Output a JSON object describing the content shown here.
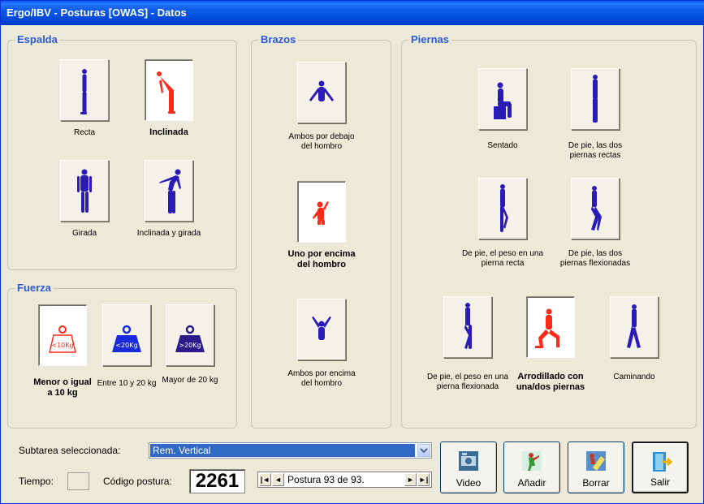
{
  "window": {
    "title": "Ergo/IBV - Posturas [OWAS] - Datos"
  },
  "groups": {
    "espalda": {
      "title": "Espalda",
      "options": [
        {
          "label": "Recta",
          "selected": false
        },
        {
          "label": "Inclinada",
          "selected": true
        },
        {
          "label": "Girada",
          "selected": false
        },
        {
          "label": "Inclinada y girada",
          "selected": false
        }
      ]
    },
    "brazos": {
      "title": "Brazos",
      "options": [
        {
          "label": "Ambos por debajo del hombro",
          "selected": false
        },
        {
          "label": "Uno por encima del hombro",
          "selected": true
        },
        {
          "label": "Ambos por encima del hombro",
          "selected": false
        }
      ]
    },
    "piernas": {
      "title": "Piernas",
      "options": [
        {
          "label": "Sentado",
          "selected": false
        },
        {
          "label": "De pie, las dos piernas rectas",
          "selected": false
        },
        {
          "label": "De pie, el peso en una pierna recta",
          "selected": false
        },
        {
          "label": "De pie, las dos piernas flexionadas",
          "selected": false
        },
        {
          "label": "De pie, el peso en una pierna flexionada",
          "selected": false
        },
        {
          "label": "Arrodillado con una/dos piernas",
          "selected": true
        },
        {
          "label": "Caminando",
          "selected": false
        }
      ]
    },
    "fuerza": {
      "title": "Fuerza",
      "options": [
        {
          "label": "Menor o igual a 10 kg",
          "weight_text": "<10Kg",
          "selected": true
        },
        {
          "label": "Entre 10 y 20 kg",
          "weight_text": "<20Kg",
          "selected": false
        },
        {
          "label": "Mayor de 20 kg",
          "weight_text": ">20Kg",
          "selected": false
        }
      ]
    }
  },
  "bottom": {
    "subtarea_label": "Subtarea seleccionada:",
    "subtarea_value": "Rem. Vertical",
    "tiempo_label": "Tiempo:",
    "codigo_label": "Código postura:",
    "codigo_value": "2261",
    "navigator_text": "Postura 93 de 93.",
    "buttons": {
      "video": "Video",
      "anadir": "Añadir",
      "borrar": "Borrar",
      "salir": "Salir"
    }
  },
  "colors": {
    "selected_figure": "#ff2a1a",
    "normal_figure": "#2a1ab8",
    "group_title": "#2b5ad6",
    "title_bar": "#0a5ae6",
    "combo_highlight": "#316ac5"
  }
}
